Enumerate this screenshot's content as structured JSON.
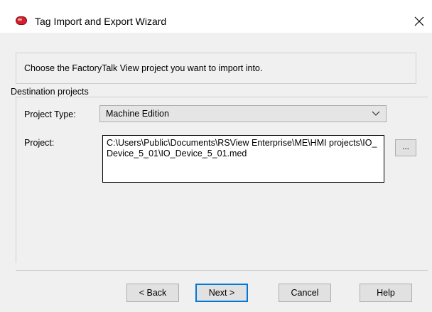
{
  "window": {
    "title": "Tag Import and Export Wizard",
    "icons": {
      "app": "red-pill-icon",
      "close": "close-icon"
    }
  },
  "instructions": "Choose the FactoryTalk View project you want to import into.",
  "destination": {
    "group_label": "Destination projects",
    "project_type_label": "Project Type:",
    "project_type_value": "Machine Edition",
    "project_label": "Project:",
    "project_path": "C:\\Users\\Public\\Documents\\RSView Enterprise\\ME\\HMI projects\\IO_Device_5_01\\IO_Device_5_01.med",
    "browse_label": "..."
  },
  "buttons": {
    "back": "< Back",
    "next": "Next >",
    "cancel": "Cancel",
    "help": "Help"
  },
  "colors": {
    "accent": "#0078d7",
    "icon_red": "#d2202f"
  }
}
